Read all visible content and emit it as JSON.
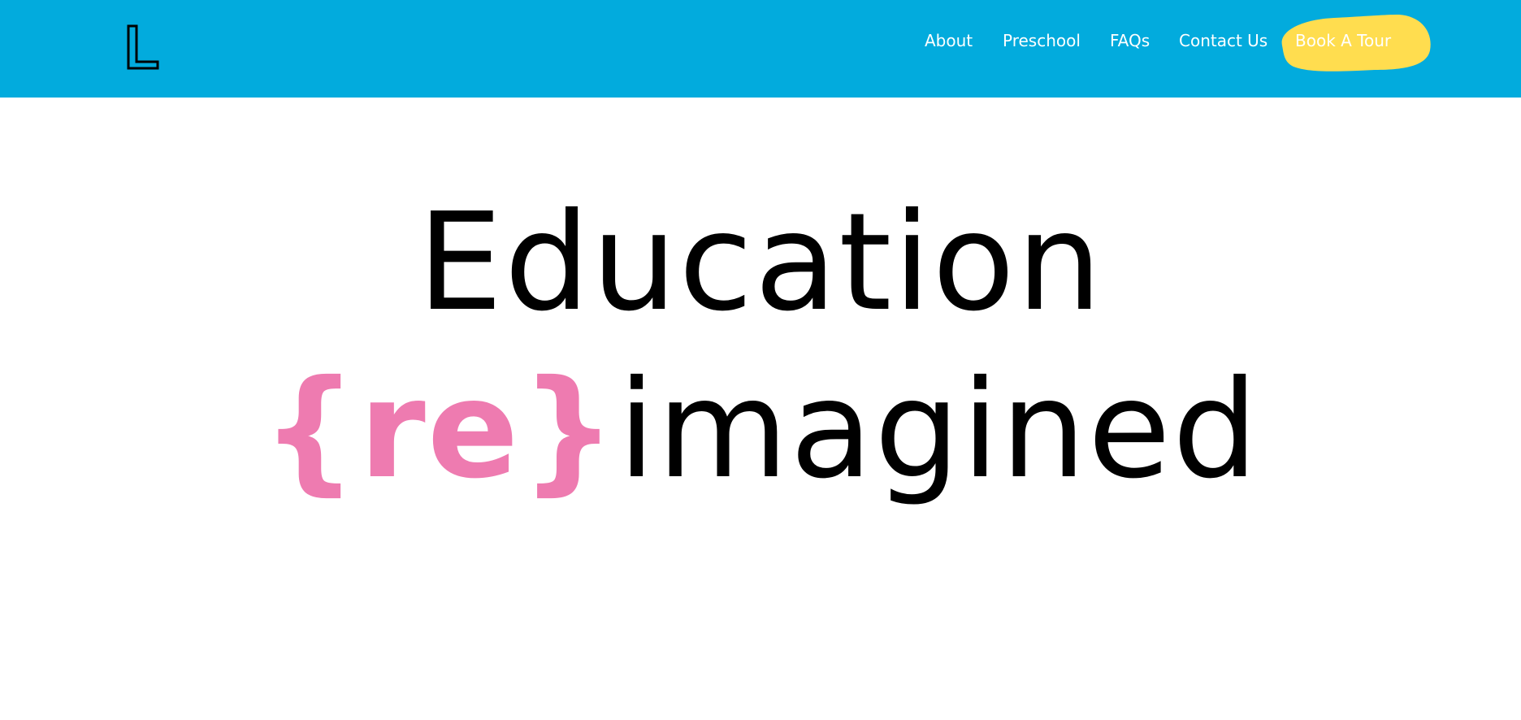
{
  "colors": {
    "header_bg": "#02abdd",
    "button_bg": "#ffdd4f",
    "accent_pink": "#ee7bb0",
    "text_dark": "#000000",
    "nav_text": "#ffffff"
  },
  "header": {
    "logo_icon": "letter-l-outline-logo",
    "nav": [
      {
        "label": "About"
      },
      {
        "label": "Preschool"
      },
      {
        "label": "FAQs"
      },
      {
        "label": "Contact Us"
      }
    ],
    "cta_label": "Book A Tour"
  },
  "hero": {
    "line1": "Education",
    "accent_prefix": "{re}",
    "line2_rest": "imagined"
  }
}
